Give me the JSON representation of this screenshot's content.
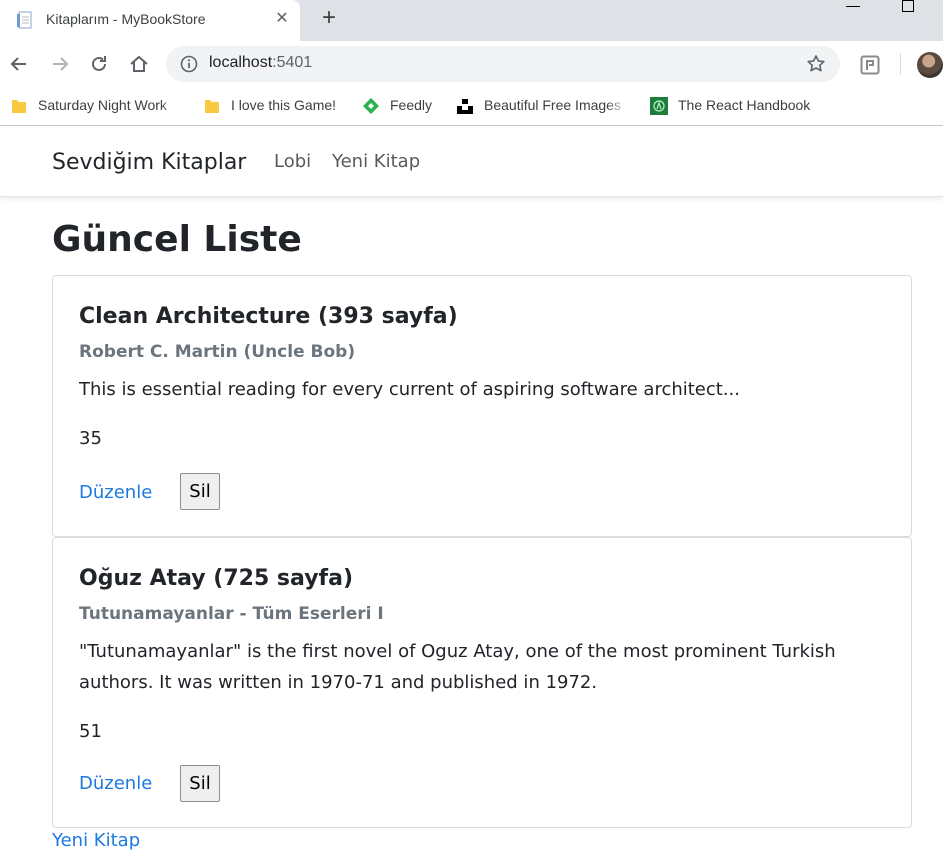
{
  "browser": {
    "tab_title": "Kitaplarım - MyBookStore",
    "url_host": "localhost",
    "url_port": ":5401",
    "bookmarks": [
      {
        "label": "Saturday Night Work",
        "icon": "folder-icon"
      },
      {
        "label": "I love this Game!",
        "icon": "folder-icon"
      },
      {
        "label": "Feedly",
        "icon": "feedly-icon"
      },
      {
        "label": "Beautiful Free Images",
        "icon": "unsplash-icon"
      },
      {
        "label": "The React Handbook",
        "icon": "react-handbook-icon"
      }
    ]
  },
  "navbar": {
    "brand": "Sevdiğim Kitaplar",
    "links": [
      "Lobi",
      "Yeni Kitap"
    ]
  },
  "page": {
    "title": "Güncel Liste",
    "books": [
      {
        "title": "Clean Architecture (393 sayfa)",
        "subtitle": "Robert C. Martin (Uncle Bob)",
        "description": "This is essential reading for every current of aspiring software architect...",
        "count": "35",
        "edit_label": "Düzenle",
        "delete_label": "Sil"
      },
      {
        "title": "Oğuz Atay (725 sayfa)",
        "subtitle": "Tutunamayanlar - Tüm Eserleri I",
        "description": "\"Tutunamayanlar\" is the first novel of Oguz Atay, one of the most prominent Turkish authors. It was written in 1970-71 and published in 1972.",
        "count": "51",
        "edit_label": "Düzenle",
        "delete_label": "Sil"
      }
    ],
    "bottom_link": "Yeni Kitap"
  },
  "colors": {
    "link": "#1b7ae0",
    "subtitle": "#6c757d",
    "text": "#212529"
  }
}
